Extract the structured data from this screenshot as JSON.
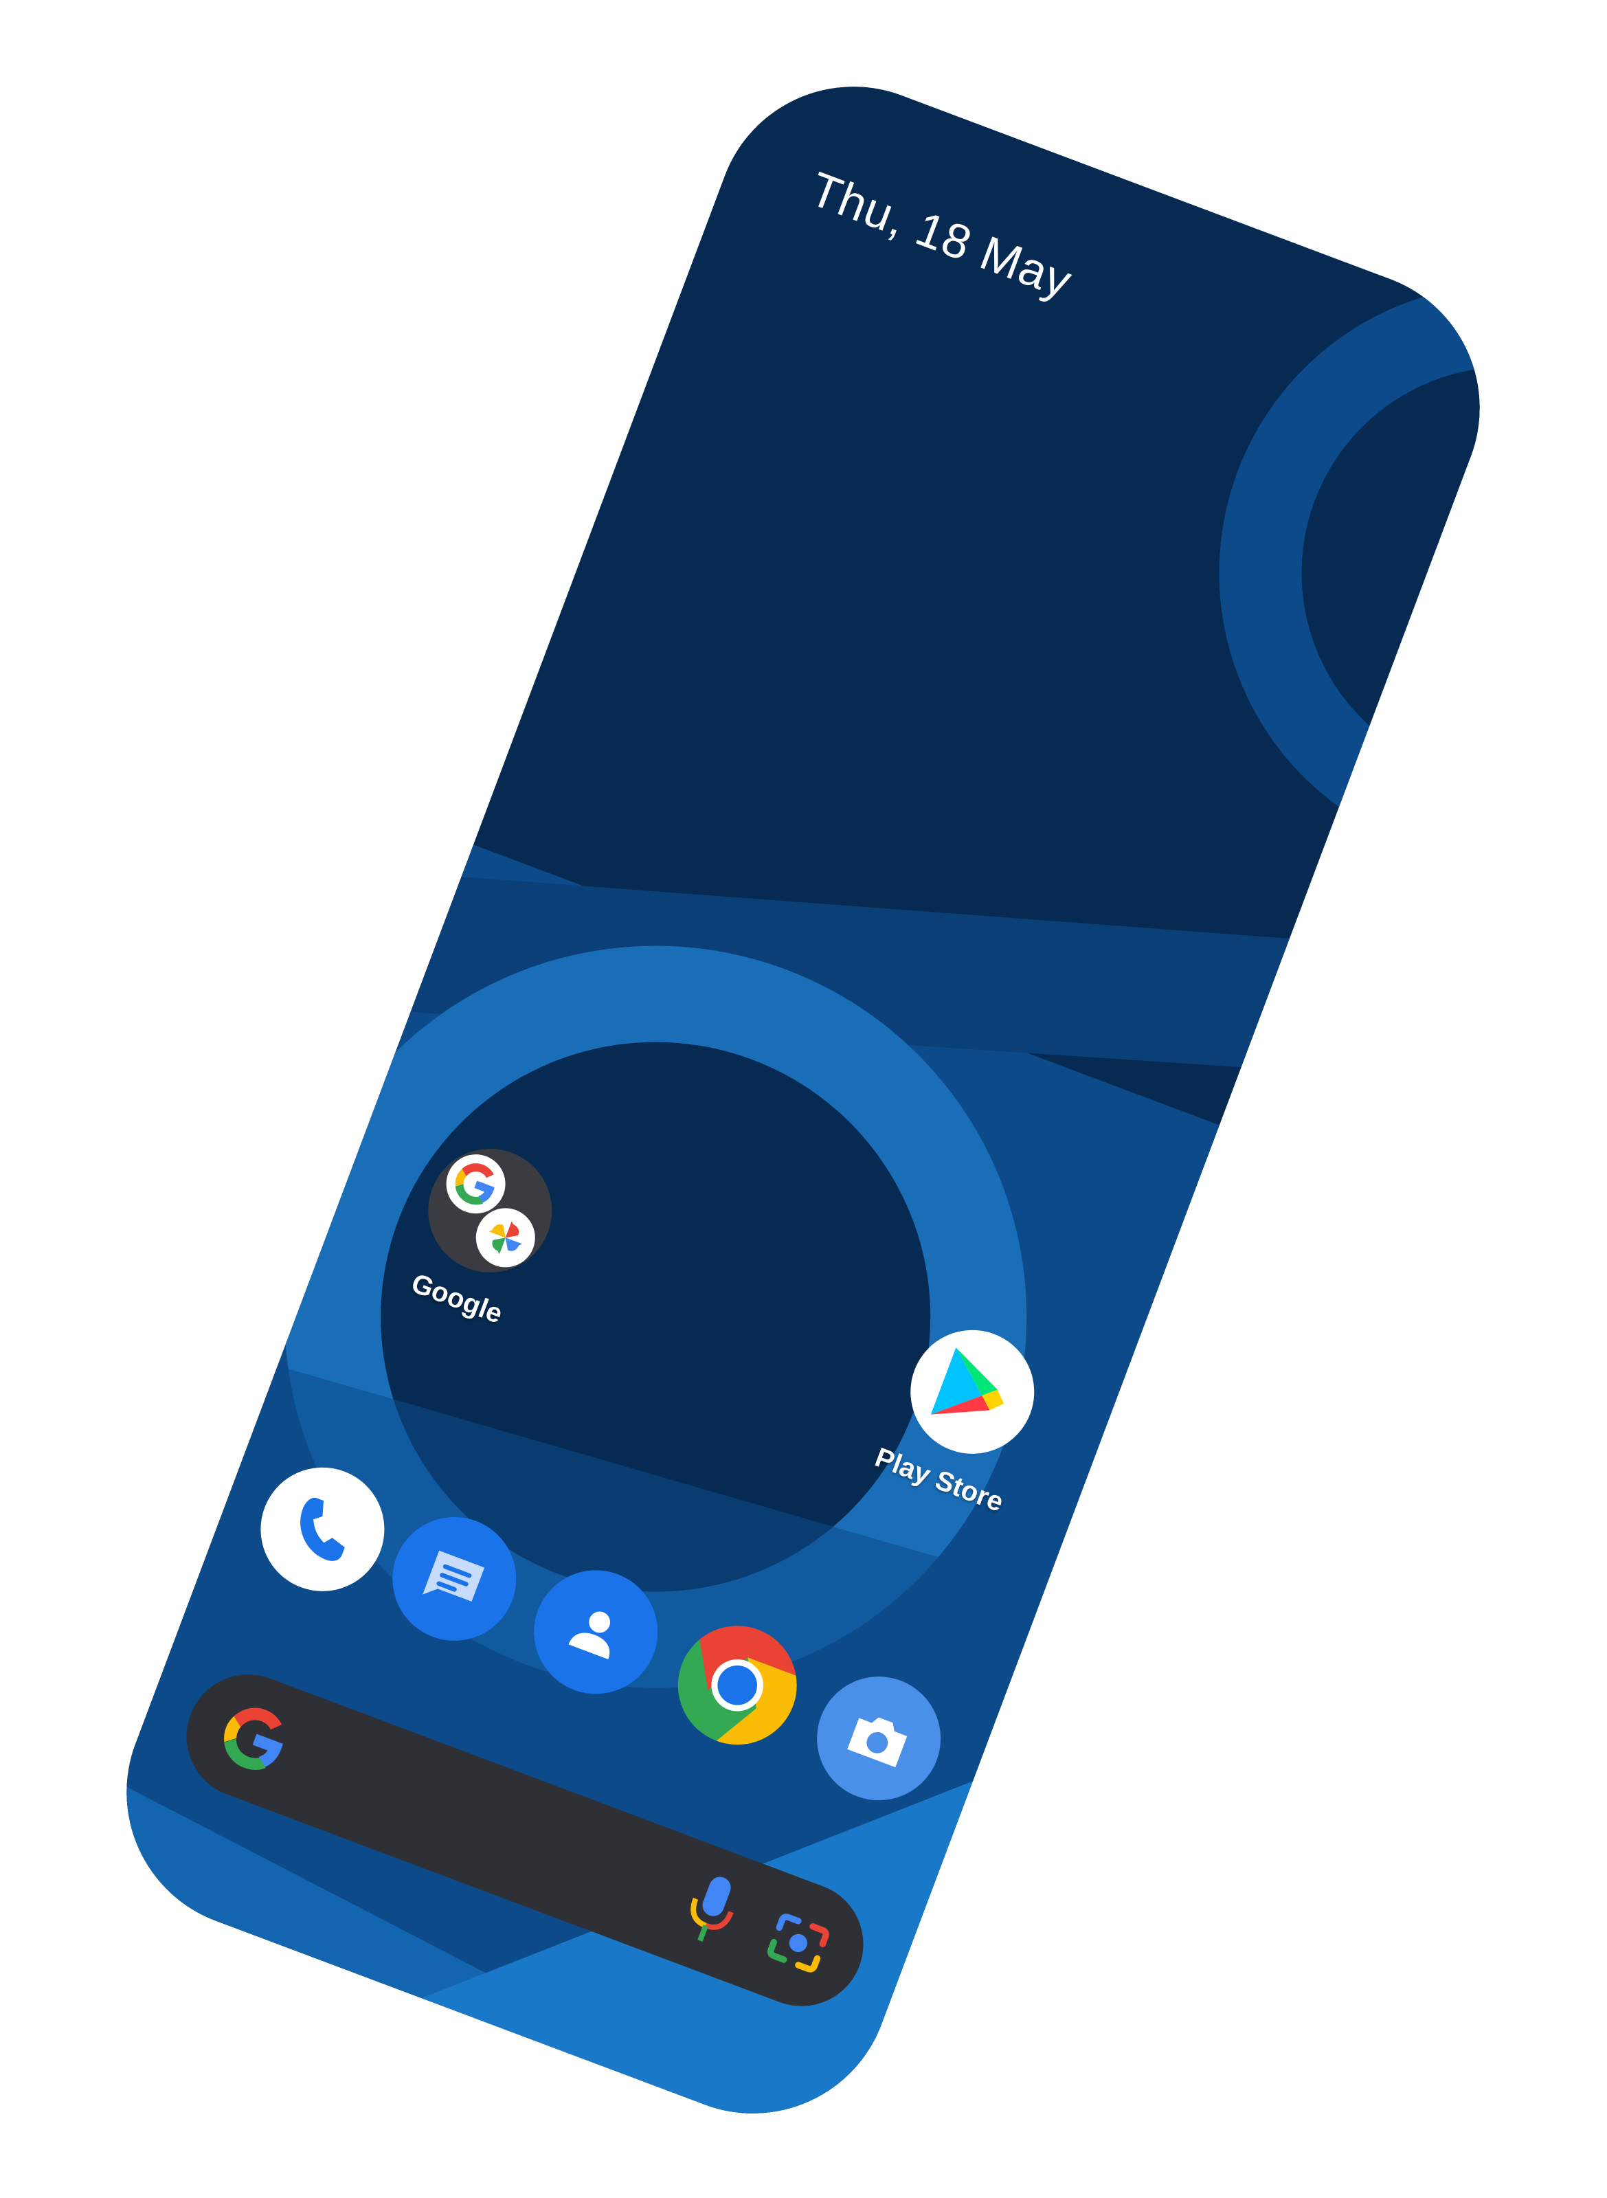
{
  "home_screen": {
    "date": "Thu, 18 May",
    "folder": {
      "label": "Google",
      "apps": [
        "google-g-icon",
        "pinwheel-photos-icon"
      ]
    },
    "apps": [
      {
        "name": "Play Store",
        "label": "Play Store",
        "icon": "play-store-icon",
        "show_label": true
      }
    ],
    "dock": [
      "phone-icon",
      "messages-icon",
      "contacts-icon",
      "chrome-icon",
      "camera-icon"
    ],
    "search_bar": {
      "icons": [
        "google-g-icon",
        "microphone-icon",
        "lens-camera-icon"
      ]
    }
  },
  "colors": {
    "wallpaper_dark": "#062a52",
    "wallpaper_mid": "#0c4a8a",
    "wallpaper_light": "#1a78c8",
    "search_bar": "#2e3035",
    "accent_blue": "#1a73e8"
  }
}
